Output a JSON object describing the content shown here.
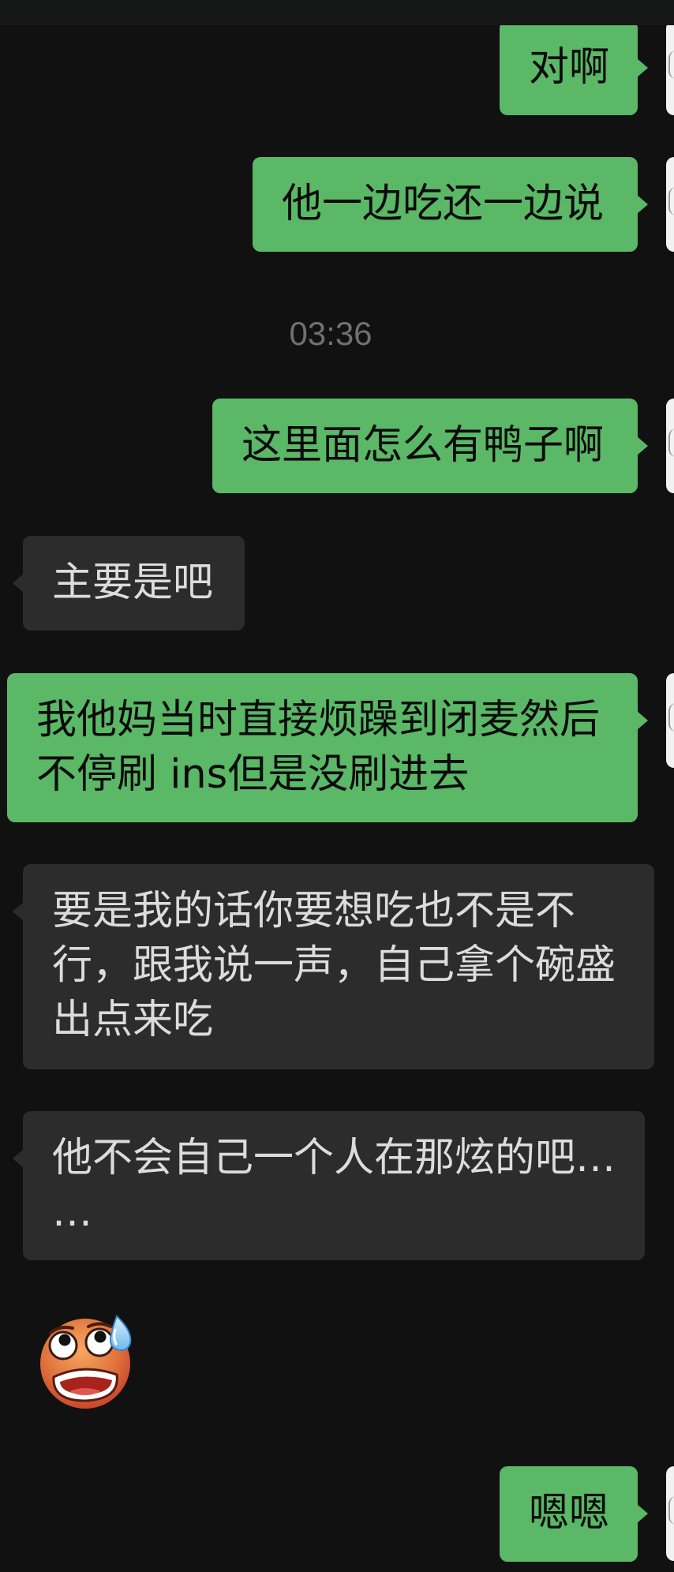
{
  "colors": {
    "background": "#111111",
    "top_bar": "#151816",
    "outgoing_bubble": "#5ab866",
    "incoming_bubble": "#2c2c2c",
    "outgoing_text": "#0b0b0b",
    "incoming_text": "#dcdcdc",
    "timestamp_text": "#707070",
    "avatar": "#f2f2f2"
  },
  "icons": {
    "avatar": "avatar-icon"
  },
  "messages": [
    {
      "outgoing": true,
      "lines": [
        "对啊"
      ]
    },
    {
      "outgoing": true,
      "lines": [
        "他一边吃还一边说"
      ]
    },
    {
      "timestamp": "03:36"
    },
    {
      "outgoing": true,
      "lines": [
        "这里面怎么有鸭子啊"
      ]
    },
    {
      "outgoing": false,
      "lines": [
        "主要是吧"
      ]
    },
    {
      "outgoing": true,
      "lines": [
        "我他妈当时直接烦躁到闭麦然后",
        "不停刷 ins但是没刷进去"
      ]
    },
    {
      "outgoing": false,
      "lines": [
        "要是我的话你要想吃也不是不",
        "行，跟我说一声，自己拿个碗盛",
        "出点来吃"
      ]
    },
    {
      "outgoing": false,
      "lines": [
        "他不会自己一个人在那炫的吧…",
        "…"
      ]
    },
    {
      "outgoing": false,
      "sticker": "anxious-face-with-sweat-icon"
    },
    {
      "outgoing": true,
      "lines": [
        "嗯嗯"
      ]
    }
  ]
}
